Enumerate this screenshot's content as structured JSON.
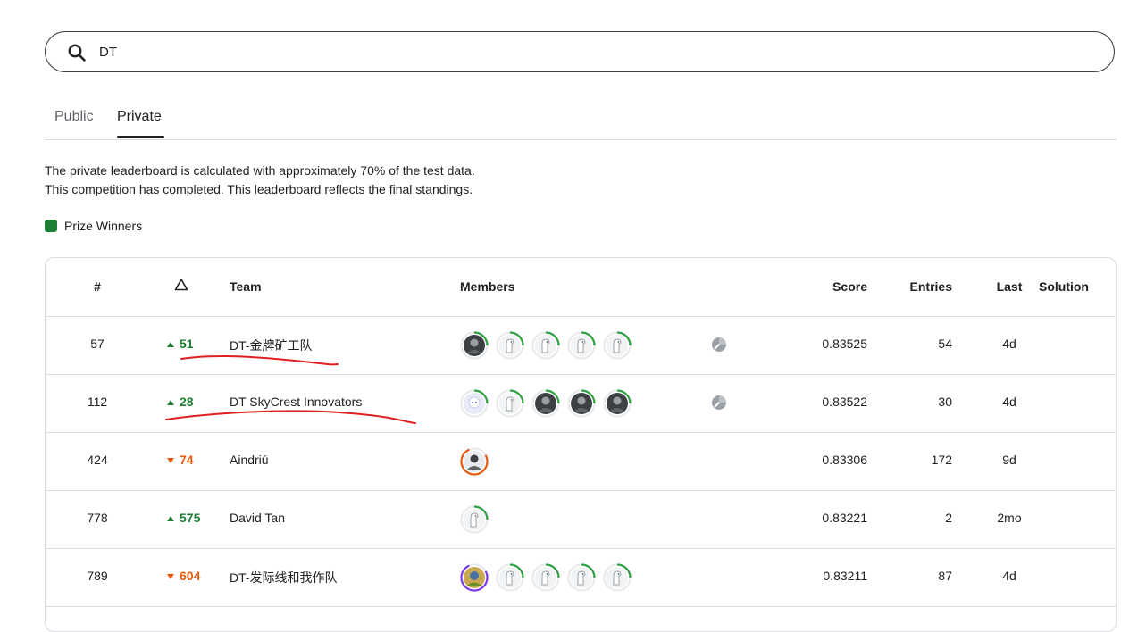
{
  "search": {
    "value": "DT"
  },
  "tabs": [
    {
      "label": "Public",
      "active": false
    },
    {
      "label": "Private",
      "active": true
    }
  ],
  "info": {
    "line1": "The private leaderboard is calculated with approximately 70% of the test data.",
    "line2": "This competition has completed. This leaderboard reflects the final standings."
  },
  "legend": {
    "label": "Prize Winners",
    "color": "#1e7e34"
  },
  "table": {
    "headers": {
      "rank": "#",
      "team": "Team",
      "members": "Members",
      "score": "Score",
      "entries": "Entries",
      "last": "Last",
      "solution": "Solution"
    },
    "rows": [
      {
        "rank": "57",
        "delta": "51",
        "direction": "up",
        "team": "DT-金牌矿工队",
        "members": [
          "photo-dark",
          "default-green",
          "default-green",
          "default-green",
          "default-green"
        ],
        "medal": true,
        "score": "0.83525",
        "entries": "54",
        "last": "4d"
      },
      {
        "rank": "112",
        "delta": "28",
        "direction": "up",
        "team": "DT SkyCrest Innovators",
        "members": [
          "anime",
          "default-green",
          "photo-dark",
          "photo-dark",
          "photo-dark"
        ],
        "medal": true,
        "score": "0.83522",
        "entries": "30",
        "last": "4d"
      },
      {
        "rank": "424",
        "delta": "74",
        "direction": "down",
        "team": "Aindriú",
        "members": [
          "photo-orange"
        ],
        "medal": false,
        "score": "0.83306",
        "entries": "172",
        "last": "9d"
      },
      {
        "rank": "778",
        "delta": "575",
        "direction": "up",
        "team": "David Tan",
        "members": [
          "default-green"
        ],
        "medal": false,
        "score": "0.83221",
        "entries": "2",
        "last": "2mo"
      },
      {
        "rank": "789",
        "delta": "604",
        "direction": "down",
        "team": "DT-发际线和我作队",
        "members": [
          "photo-purple",
          "default-green",
          "default-green",
          "default-green",
          "default-green"
        ],
        "medal": false,
        "score": "0.83211",
        "entries": "87",
        "last": "4d"
      }
    ]
  },
  "colors": {
    "up": "#1e7e34",
    "down": "#e8590c",
    "annotation": "#e02020"
  }
}
